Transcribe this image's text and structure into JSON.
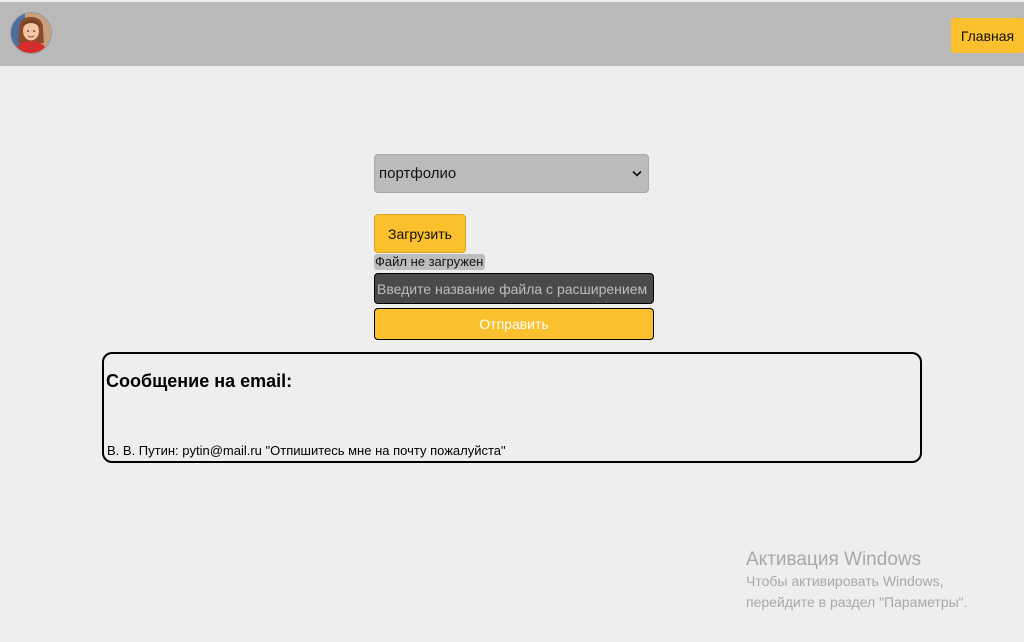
{
  "header": {
    "avatar_icon": "user-photo",
    "home_label": "Главная"
  },
  "form": {
    "category_select": {
      "value": "портфолио"
    },
    "upload_label": "Загрузить",
    "file_status": "Файл не загружен",
    "filename_placeholder": "Введите название файла с расширением",
    "send_label": "Отправить"
  },
  "message": {
    "title": "Сообщение на email:",
    "line": "В. В. Путин: pytin@mail.ru \"Отпишитесь мне на почту пожалуйста\""
  },
  "windows_activation": {
    "title": "Активация Windows",
    "line1": "Чтобы активировать Windows,",
    "line2": "перейдите в раздел \"Параметры\"."
  },
  "colors": {
    "accent": "#fbc02d",
    "header_bg": "#b9b9b9",
    "page_bg": "#eeeeee",
    "input_bg": "#4a4a4a"
  }
}
